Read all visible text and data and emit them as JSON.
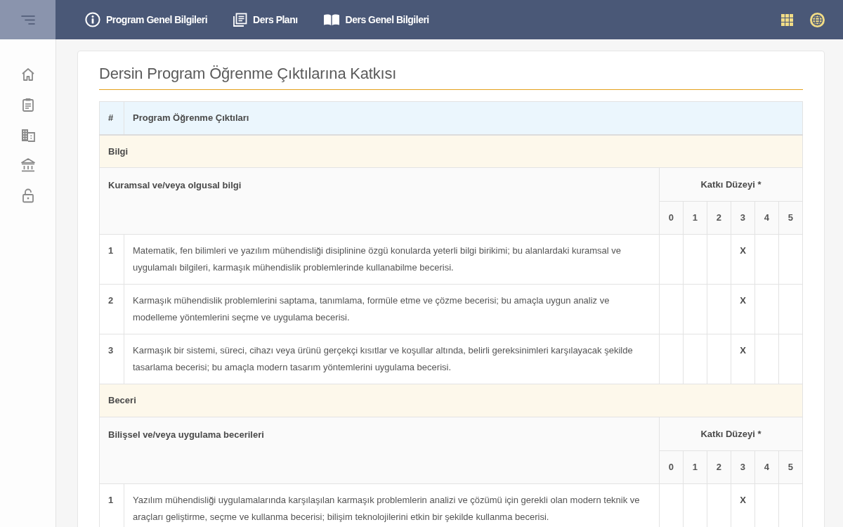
{
  "navbar": {
    "links": [
      {
        "label": "Program Genel Bilgileri"
      },
      {
        "label": "Ders Planı"
      },
      {
        "label": "Ders Genel Bilgileri"
      }
    ]
  },
  "page": {
    "title": "Dersin Program Öğrenme Çıktılarına Katkısı"
  },
  "table": {
    "columns": [
      "#",
      "Program Öğrenme Çıktıları"
    ],
    "sections": [
      {
        "title": "Bilgi",
        "groups": [
          {
            "title": "Kuramsal ve/veya olgusal bilgi",
            "level_heading": "Katkı Düzeyi *",
            "levels": [
              "0",
              "1",
              "2",
              "3",
              "4",
              "5"
            ],
            "rows": [
              {
                "number": "1",
                "text": "Matematik, fen bilimleri ve yazılım mühendisliği disiplinine özgü konularda yeterli bilgi birikimi; bu alanlardaki kuramsal ve uygulamalı bilgileri, karmaşık mühendislik problemlerinde kullanabilme becerisi.",
                "cells": [
                  {
                    "kind": "blank"
                  },
                  {
                    "kind": "blank"
                  },
                  {
                    "kind": "blank"
                  },
                  {
                    "kind": "mark",
                    "text": "X"
                  },
                  {
                    "kind": "blank"
                  },
                  {
                    "kind": "blank"
                  }
                ]
              },
              {
                "number": "2",
                "text": "Karmaşık mühendislik problemlerini saptama, tanımlama, formüle etme ve çözme becerisi; bu amaçla uygun analiz ve modelleme yöntemlerini seçme ve uygulama becerisi.",
                "cells": [
                  {
                    "kind": "blank"
                  },
                  {
                    "kind": "blank"
                  },
                  {
                    "kind": "blank"
                  },
                  {
                    "kind": "mark",
                    "text": "X"
                  },
                  {
                    "kind": "blank"
                  },
                  {
                    "kind": "blank"
                  }
                ]
              },
              {
                "number": "3",
                "text": "Karmaşık bir sistemi, süreci, cihazı veya ürünü gerçekçi kısıtlar ve koşullar altında, belirli gereksinimleri karşılayacak şekilde tasarlama becerisi; bu amaçla modern tasarım yöntemlerini uygulama becerisi.",
                "cells": [
                  {
                    "kind": "blank"
                  },
                  {
                    "kind": "blank"
                  },
                  {
                    "kind": "blank"
                  },
                  {
                    "kind": "mark",
                    "text": "X"
                  },
                  {
                    "kind": "blank"
                  },
                  {
                    "kind": "blank"
                  }
                ]
              }
            ]
          }
        ]
      },
      {
        "title": "Beceri",
        "groups": [
          {
            "title": "Bilişsel ve/veya uygulama becerileri",
            "level_heading": "Katkı Düzeyi *",
            "levels": [
              "0",
              "1",
              "2",
              "3",
              "4",
              "5"
            ],
            "rows": [
              {
                "number": "1",
                "text": "Yazılım mühendisliği uygulamalarında karşılaşılan karmaşık problemlerin analizi ve çözümü için gerekli olan modern teknik ve araçları geliştirme, seçme ve kullanma becerisi; bilişim teknolojilerini etkin bir şekilde kullanma becerisi.",
                "cells": [
                  {
                    "kind": "blank"
                  },
                  {
                    "kind": "blank"
                  },
                  {
                    "kind": "blank"
                  },
                  {
                    "kind": "mark",
                    "text": "X"
                  },
                  {
                    "kind": "blank"
                  },
                  {
                    "kind": "blank"
                  }
                ]
              }
            ]
          }
        ]
      }
    ]
  }
}
